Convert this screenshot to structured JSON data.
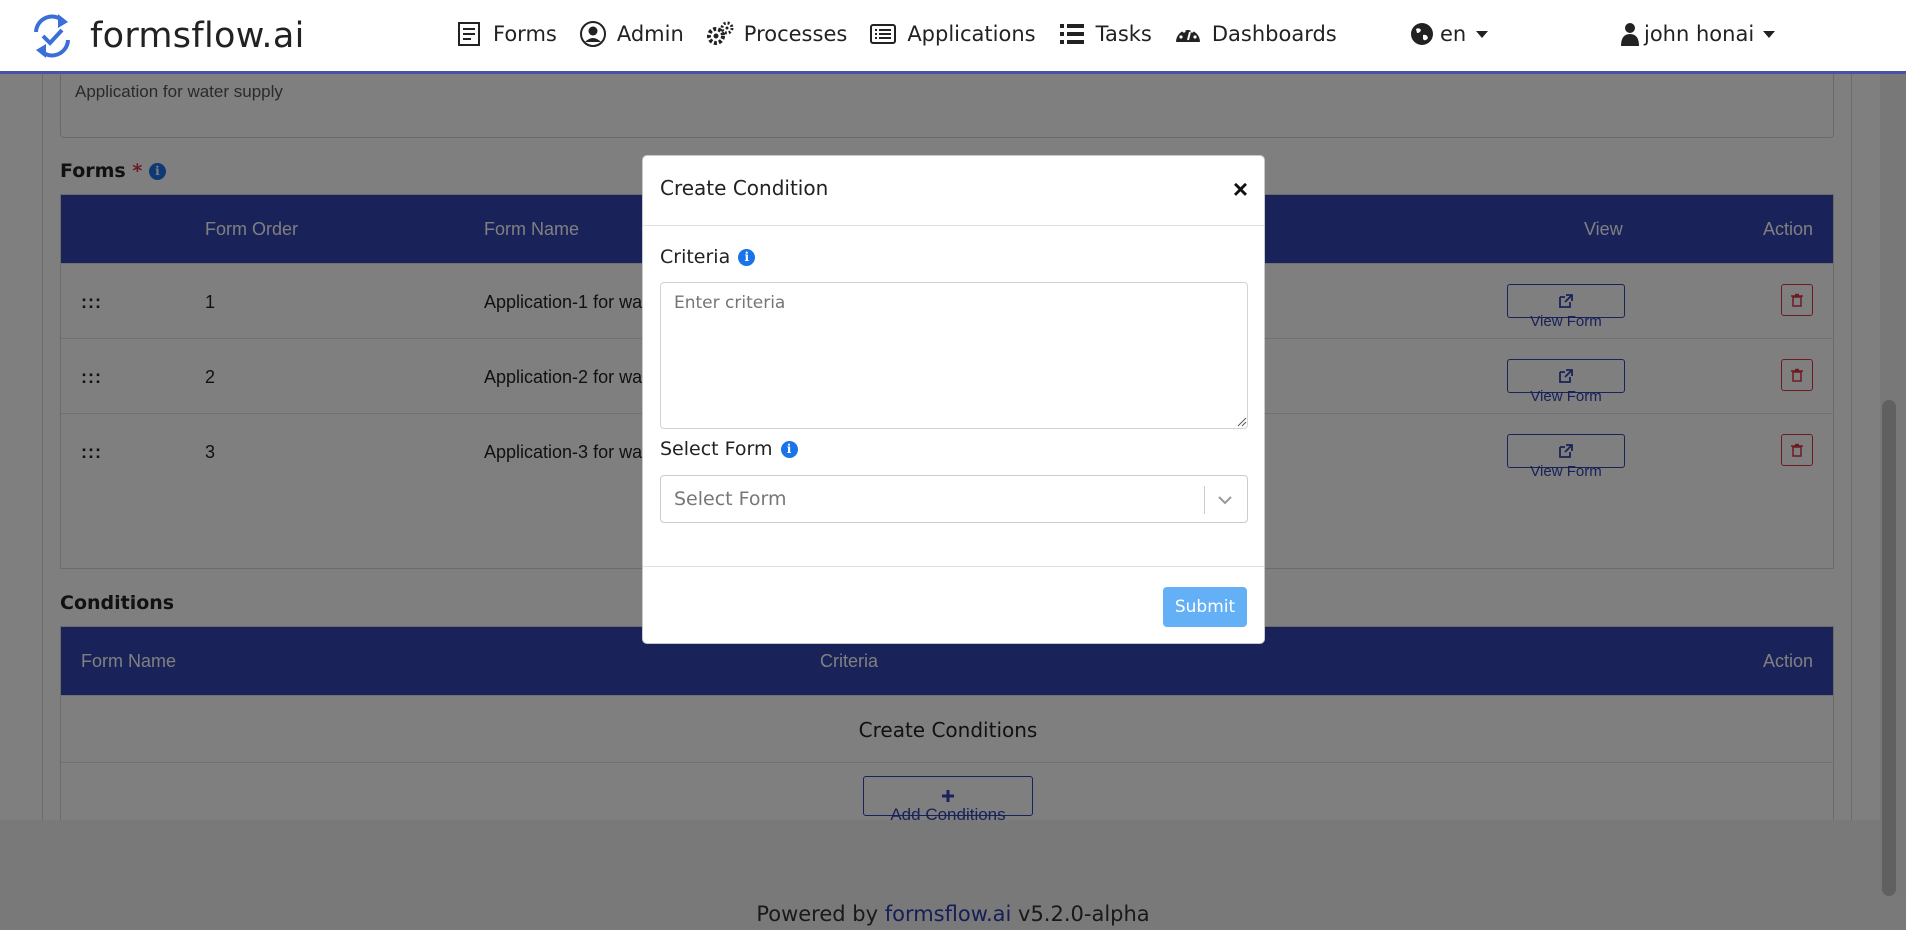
{
  "brand": {
    "name": "formsflow.ai"
  },
  "nav": {
    "items": [
      {
        "label": "Forms",
        "icon": "forms-icon"
      },
      {
        "label": "Admin",
        "icon": "admin-icon"
      },
      {
        "label": "Processes",
        "icon": "processes-icon"
      },
      {
        "label": "Applications",
        "icon": "applications-icon"
      },
      {
        "label": "Tasks",
        "icon": "tasks-icon"
      },
      {
        "label": "Dashboards",
        "icon": "dashboards-icon"
      }
    ],
    "language": "en",
    "user": "john honai"
  },
  "description": {
    "value": "Application for water supply"
  },
  "forms_section": {
    "title": "Forms",
    "required_mark": "*",
    "columns": [
      "Form Order",
      "Form Name",
      "View",
      "Action"
    ],
    "rows": [
      {
        "order": "1",
        "name": "Application-1 for wa",
        "view_label": "View Form"
      },
      {
        "order": "2",
        "name": "Application-2 for wa",
        "view_label": "View Form"
      },
      {
        "order": "3",
        "name": "Application-3 for wa",
        "view_label": "View Form"
      }
    ]
  },
  "conditions_section": {
    "title": "Conditions",
    "columns": [
      "Form Name",
      "Criteria",
      "Action"
    ],
    "empty_text": "Create Conditions",
    "add_label": "Add Conditions"
  },
  "modal": {
    "title": "Create Condition",
    "close_glyph": "×",
    "criteria_label": "Criteria",
    "criteria_placeholder": "Enter criteria",
    "select_label": "Select Form",
    "select_placeholder": "Select Form",
    "submit_label": "Submit"
  },
  "footer": {
    "prefix": "Powered by",
    "link": "formsflow.ai",
    "version": "v5.2.0-alpha"
  },
  "colors": {
    "primary": "#3245b2",
    "accent": "#1a73e8",
    "danger": "#dc3545",
    "submit": "#63b0f7"
  }
}
